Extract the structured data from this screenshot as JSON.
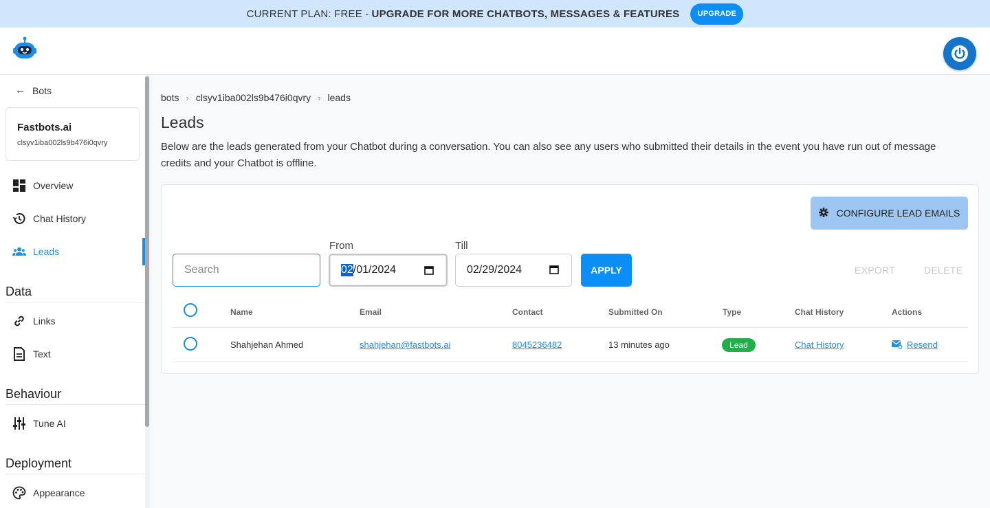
{
  "banner": {
    "plan_text": "CURRENT PLAN: FREE -",
    "upgrade_text": "UPGRADE FOR MORE CHATBOTS, MESSAGES & FEATURES",
    "upgrade_button": "UPGRADE",
    "bg_color": "#cfe6fd"
  },
  "header": {
    "logo_icon": "robot-logo-icon",
    "power_icon": "power-icon"
  },
  "sidebar": {
    "back_label": "Bots",
    "bot_name": "Fastbots.ai",
    "bot_id": "clsyv1iba002ls9b476i0qvry",
    "items": [
      {
        "label": "Overview",
        "icon": "dashboard-icon"
      },
      {
        "label": "Chat History",
        "icon": "history-icon"
      },
      {
        "label": "Leads",
        "icon": "people-icon",
        "active": true
      }
    ],
    "sections": [
      {
        "title": "Data",
        "items": [
          {
            "label": "Links",
            "icon": "link-icon"
          },
          {
            "label": "Text",
            "icon": "document-icon"
          }
        ]
      },
      {
        "title": "Behaviour",
        "items": [
          {
            "label": "Tune AI",
            "icon": "sliders-icon"
          }
        ]
      },
      {
        "title": "Deployment",
        "items": [
          {
            "label": "Appearance",
            "icon": "palette-icon"
          }
        ]
      }
    ]
  },
  "breadcrumb": [
    "bots",
    "clsyv1iba002ls9b476i0qvry",
    "leads"
  ],
  "page": {
    "title": "Leads",
    "description": "Below are the leads generated from your Chatbot during a conversation. You can also see any users who submitted their details in the event you have run out of message credits and your Chatbot is offline."
  },
  "toolbar": {
    "configure_label": "CONFIGURE LEAD EMAILS",
    "search_placeholder": "Search",
    "from_label": "From",
    "from_month": "02",
    "from_rest": "/01/2024",
    "till_label": "Till",
    "till_value": "02/29/2024",
    "apply_label": "APPLY",
    "export_label": "EXPORT",
    "delete_label": "DELETE"
  },
  "table": {
    "columns": [
      "Name",
      "Email",
      "Contact",
      "Submitted On",
      "Type",
      "Chat History",
      "Actions"
    ],
    "rows": [
      {
        "name": "Shahjehan Ahmed",
        "email": "shahjehan@fastbots.ai",
        "contact": "8045236482",
        "submitted_on": "13 minutes ago",
        "type": "Lead",
        "chat_history": "Chat History",
        "action": "Resend"
      }
    ]
  },
  "colors": {
    "accent": "#1a8fe3",
    "primary_button": "#0b8ef5",
    "lead_badge": "#20b04a"
  }
}
